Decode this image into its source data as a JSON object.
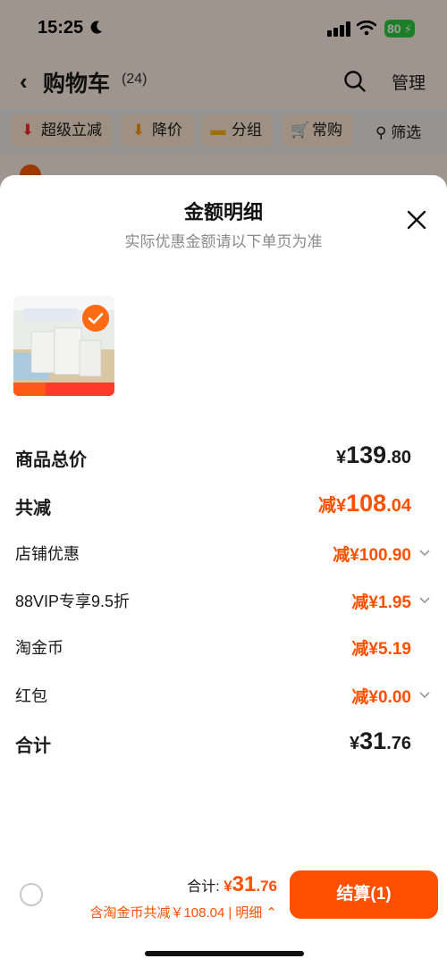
{
  "status_bar": {
    "time": "15:25",
    "battery": "80"
  },
  "nav": {
    "title": "购物车",
    "count": "(24)",
    "manage": "管理"
  },
  "filters": [
    {
      "label": "超级立减",
      "icon": "arrow-down-icon"
    },
    {
      "label": "降价",
      "icon": "arrow-down-icon"
    },
    {
      "label": "分组",
      "icon": "folder-icon"
    },
    {
      "label": "常购",
      "icon": "cart-icon"
    }
  ],
  "filter_button": "筛选",
  "sheet": {
    "title": "金额明细",
    "subtitle": "实际优惠金额请以下单页为准"
  },
  "product": {
    "thumb_title": "补水又补光 第二",
    "thumb_brand": "PMPM",
    "thumb_badge": "29",
    "thumb_footer": "入会领券享更多优惠"
  },
  "breakdown": {
    "total_price": {
      "label": "商品总价",
      "currency": "¥",
      "int": "139",
      "dec": ".80"
    },
    "total_discount": {
      "label": "共减",
      "prefix": "减¥",
      "int": "108",
      "dec": ".04"
    },
    "store_discount": {
      "label": "店铺优惠",
      "prefix": "减¥",
      "int": "100",
      "dec": ".90"
    },
    "vip_discount": {
      "label": "88VIP专享9.5折",
      "prefix": "减¥",
      "int": "1",
      "dec": ".95"
    },
    "coins": {
      "label": "淘金币",
      "prefix": "减¥",
      "int": "5",
      "dec": ".19"
    },
    "red_packet": {
      "label": "红包",
      "prefix": "减¥",
      "int": "0",
      "dec": ".00"
    },
    "sum": {
      "label": "合计",
      "currency": "¥",
      "int": "31",
      "dec": ".76"
    }
  },
  "bottom_bar": {
    "total_label": "合计:",
    "currency": "¥",
    "total_int": "31",
    "total_dec": ".76",
    "saving_text": "含淘金币共减￥108.04",
    "separator": "|",
    "detail_label": "明细",
    "checkout_label": "结算(1)"
  },
  "colors": {
    "accent": "#ff5000",
    "check": "#ff6a14"
  }
}
